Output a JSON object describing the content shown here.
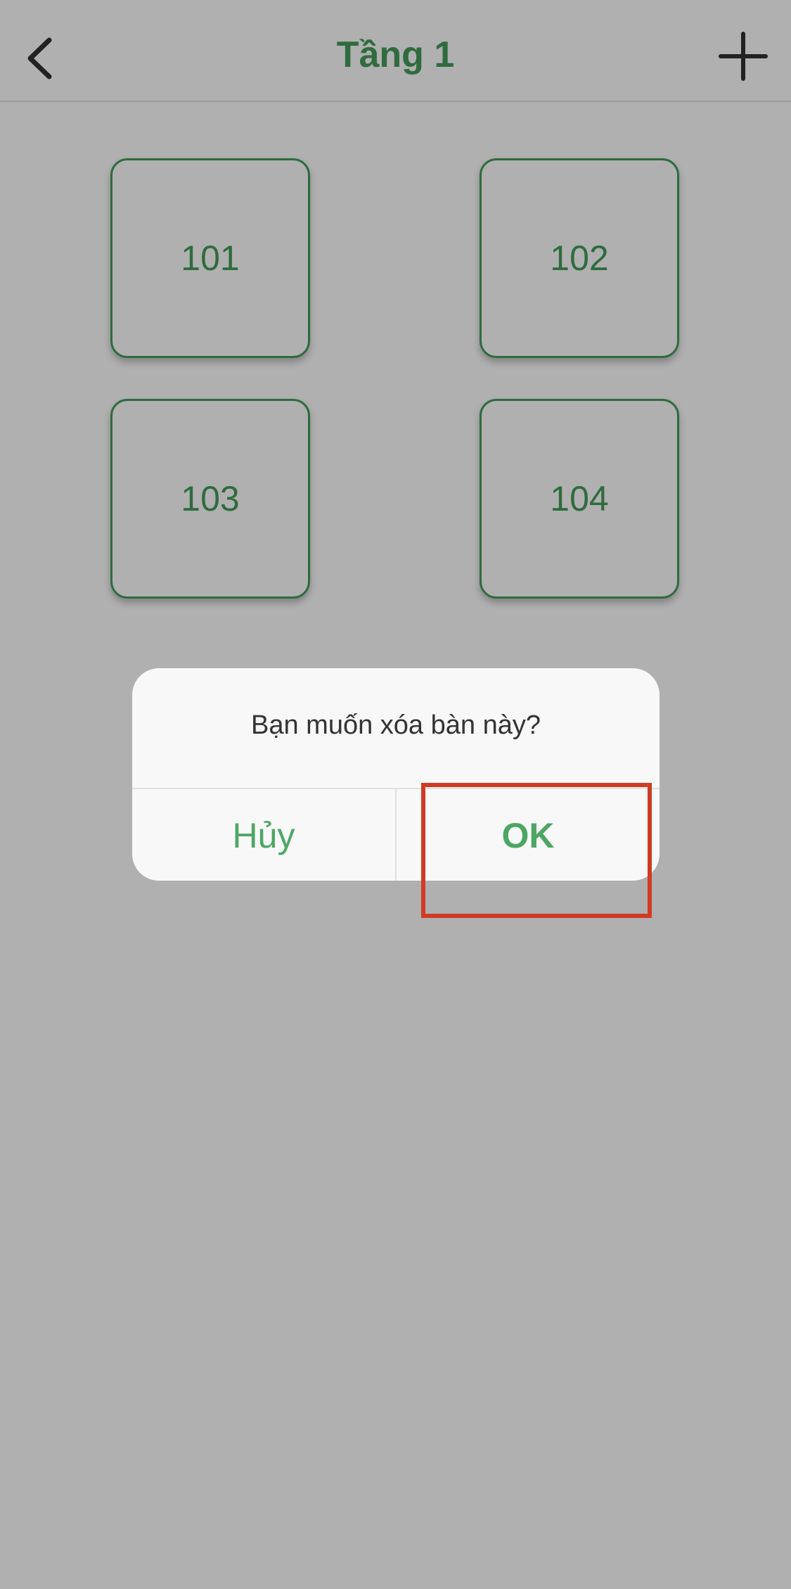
{
  "app": {
    "title": "Tầng 1",
    "back_icon": "chevron-left-icon",
    "add_icon": "plus-icon"
  },
  "tables": [
    {
      "label": "101"
    },
    {
      "label": "102"
    },
    {
      "label": "103"
    },
    {
      "label": "104"
    }
  ],
  "dialog": {
    "message": "Bạn muốn xóa bàn này?",
    "cancel_label": "Hủy",
    "ok_label": "OK"
  },
  "colors": {
    "accent_green": "#2f6b3e",
    "button_green": "#4ea665",
    "highlight_red": "#d13b23",
    "overlay_gray": "#b0b0b0"
  }
}
